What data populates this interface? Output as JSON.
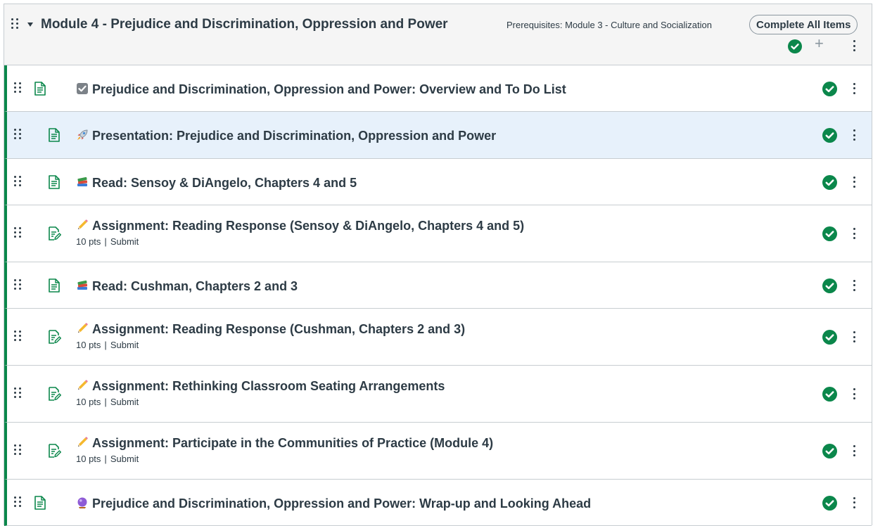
{
  "module": {
    "title": "Module 4 - Prejudice and Discrimination, Oppression and Power",
    "prerequisites": "Prerequisites: Module 3 - Culture and Socialization",
    "requirement": "Complete All Items",
    "accent_color": "#0b874b",
    "icons": [
      "drag-handle-icon",
      "collapse-caret-icon",
      "published-check-icon",
      "add-icon",
      "kebab-menu-icon"
    ]
  },
  "items": [
    {
      "title": "Prejudice and Discrimination, Oppression and Power: Overview and To Do List",
      "emoji": "checkbox",
      "type": "page",
      "points": "",
      "action": ""
    },
    {
      "title": "Presentation: Prejudice and Discrimination, Oppression and Power",
      "emoji": "rocket",
      "type": "page",
      "points": "",
      "action": ""
    },
    {
      "title": "Read: Sensoy & DiAngelo, Chapters 4 and 5",
      "emoji": "books",
      "type": "page",
      "points": "",
      "action": ""
    },
    {
      "title": "Assignment: Reading Response (Sensoy & DiAngelo, Chapters 4 and 5)",
      "emoji": "pencil",
      "type": "assignment",
      "points": "10 pts",
      "action": "Submit"
    },
    {
      "title": "Read: Cushman, Chapters 2 and 3",
      "emoji": "books",
      "type": "page",
      "points": "",
      "action": ""
    },
    {
      "title": "Assignment: Reading Response (Cushman, Chapters 2 and 3)",
      "emoji": "pencil",
      "type": "assignment",
      "points": "10 pts",
      "action": "Submit"
    },
    {
      "title": "Assignment: Rethinking Classroom Seating Arrangements",
      "emoji": "pencil",
      "type": "assignment",
      "points": "10 pts",
      "action": "Submit"
    },
    {
      "title": "Assignment: Participate in the Communities of Practice (Module 4)",
      "emoji": "pencil",
      "type": "assignment",
      "points": "10 pts",
      "action": "Submit"
    },
    {
      "title": "Prejudice and Discrimination, Oppression and Power: Wrap-up and Looking Ahead",
      "emoji": "crystal-ball",
      "type": "page",
      "points": "",
      "action": ""
    }
  ]
}
